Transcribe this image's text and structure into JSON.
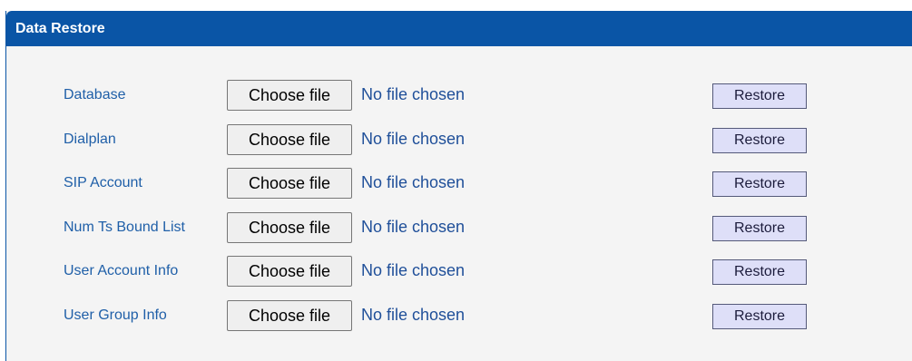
{
  "panel": {
    "title": "Data Restore"
  },
  "rows": [
    {
      "label": "Database",
      "choose_label": "Choose file",
      "file_status": "No file chosen",
      "restore_label": "Restore"
    },
    {
      "label": "Dialplan",
      "choose_label": "Choose file",
      "file_status": "No file chosen",
      "restore_label": "Restore"
    },
    {
      "label": "SIP Account",
      "choose_label": "Choose file",
      "file_status": "No file chosen",
      "restore_label": "Restore"
    },
    {
      "label": "Num Ts Bound List",
      "choose_label": "Choose file",
      "file_status": "No file chosen",
      "restore_label": "Restore"
    },
    {
      "label": "User Account Info",
      "choose_label": "Choose file",
      "file_status": "No file chosen",
      "restore_label": "Restore"
    },
    {
      "label": "User Group Info",
      "choose_label": "Choose file",
      "file_status": "No file chosen",
      "restore_label": "Restore"
    }
  ],
  "colors": {
    "header": "#0a55a6",
    "label": "#1f5fa8",
    "restore_button": "#dedff8"
  }
}
